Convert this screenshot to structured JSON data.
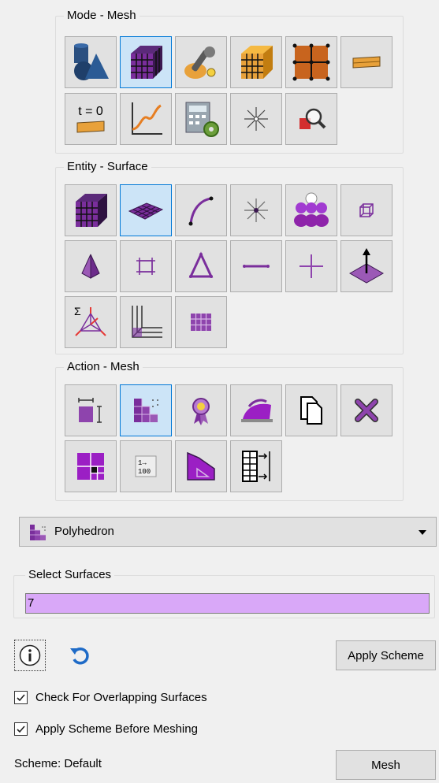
{
  "mode_group": {
    "title": "Mode - Mesh"
  },
  "entity_group": {
    "title": "Entity - Surface"
  },
  "action_group": {
    "title": "Action - Mesh"
  },
  "mode_buttons": [
    {
      "icon": "geometry-icon",
      "active": false
    },
    {
      "icon": "mesh-cube-icon",
      "active": true
    },
    {
      "icon": "tools-icon",
      "active": false
    },
    {
      "icon": "orange-mesh-cube-icon",
      "active": false
    },
    {
      "icon": "grid-nodes-icon",
      "active": false
    },
    {
      "icon": "bar-element-icon",
      "active": false
    },
    {
      "icon": "time-zero-icon",
      "active": false,
      "text": "t = 0"
    },
    {
      "icon": "graph-icon",
      "active": false
    },
    {
      "icon": "calculator-gear-icon",
      "active": false
    },
    {
      "icon": "star-burst-icon",
      "active": false
    },
    {
      "icon": "magnify-icon",
      "active": false
    }
  ],
  "entity_buttons": [
    {
      "icon": "volume-mesh-icon",
      "active": false
    },
    {
      "icon": "surface-icon",
      "active": true
    },
    {
      "icon": "curve-icon",
      "active": false
    },
    {
      "icon": "vertex-star-icon",
      "active": false
    },
    {
      "icon": "group-icon",
      "active": false
    },
    {
      "icon": "hex-element-icon",
      "active": false
    },
    {
      "icon": "tet-element-icon",
      "active": false
    },
    {
      "icon": "quad-element-icon",
      "active": false
    },
    {
      "icon": "tri-element-icon",
      "active": false
    },
    {
      "icon": "edge-element-icon",
      "active": false
    },
    {
      "icon": "node-element-icon",
      "active": false
    },
    {
      "icon": "surface-normal-icon",
      "active": false
    },
    {
      "icon": "sum-nodeset-icon",
      "active": false
    },
    {
      "icon": "boundary-layer-icon",
      "active": false
    },
    {
      "icon": "face-grid-icon",
      "active": false
    }
  ],
  "action_buttons": [
    {
      "icon": "interval-icon",
      "active": false
    },
    {
      "icon": "scheme-icon",
      "active": true
    },
    {
      "icon": "quality-ribbon-icon",
      "active": false
    },
    {
      "icon": "smooth-iron-icon",
      "active": false
    },
    {
      "icon": "copy-mesh-icon",
      "active": false
    },
    {
      "icon": "delete-mesh-icon",
      "active": false
    },
    {
      "icon": "refine-icon",
      "active": false
    },
    {
      "icon": "renumber-icon",
      "active": false,
      "text_top": "1→",
      "text_bottom": "100"
    },
    {
      "icon": "sizing-function-icon",
      "active": false
    },
    {
      "icon": "matching-intervals-icon",
      "active": false
    }
  ],
  "scheme_dropdown": {
    "value": "Polyhedron"
  },
  "select_surfaces": {
    "title": "Select Surfaces",
    "value": "7"
  },
  "apply_scheme_button": {
    "label": "Apply Scheme"
  },
  "checkboxes": {
    "overlap": {
      "label": "Check For Overlapping Surfaces",
      "checked": true
    },
    "apply_before": {
      "label": "Apply Scheme Before Meshing",
      "checked": true
    }
  },
  "scheme_status": {
    "label": "Scheme: Default"
  },
  "mesh_button": {
    "label": "Mesh"
  },
  "colors": {
    "purple": "#7a2e9c",
    "light_purple": "#d9a8f8",
    "active_bg": "#cce4f7",
    "active_border": "#0078d7",
    "orange": "#e8a13a"
  }
}
